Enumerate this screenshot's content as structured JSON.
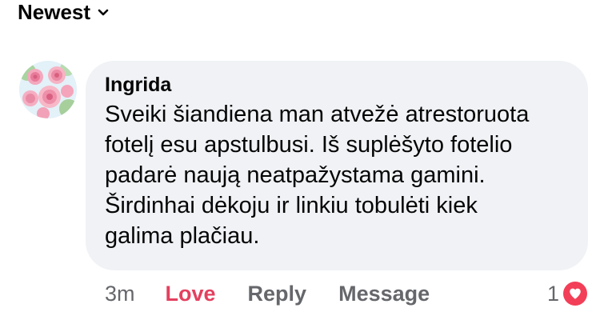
{
  "sort": {
    "label": "Newest",
    "icon": "chevron-down-icon"
  },
  "comment": {
    "author": "Ingrida",
    "lines": [
      "Sveiki šiandiena man atvežė atrestoruota",
      "fotelį esu apstulbusi. Iš suplėšyto fotelio",
      "padarė naują neatpažystama gamini.",
      "Širdinhai dėkoju ir linkiu tobulėti kiek",
      "galima plačiau."
    ]
  },
  "actions": {
    "time": "3m",
    "love_label": "Love",
    "reply_label": "Reply",
    "message_label": "Message"
  },
  "reactions": {
    "count": "1",
    "type": "heart-icon",
    "color": "#f33e58"
  },
  "colors": {
    "love": "#e4405f",
    "bubble": "#f0f2f5",
    "meta": "#65676b"
  }
}
